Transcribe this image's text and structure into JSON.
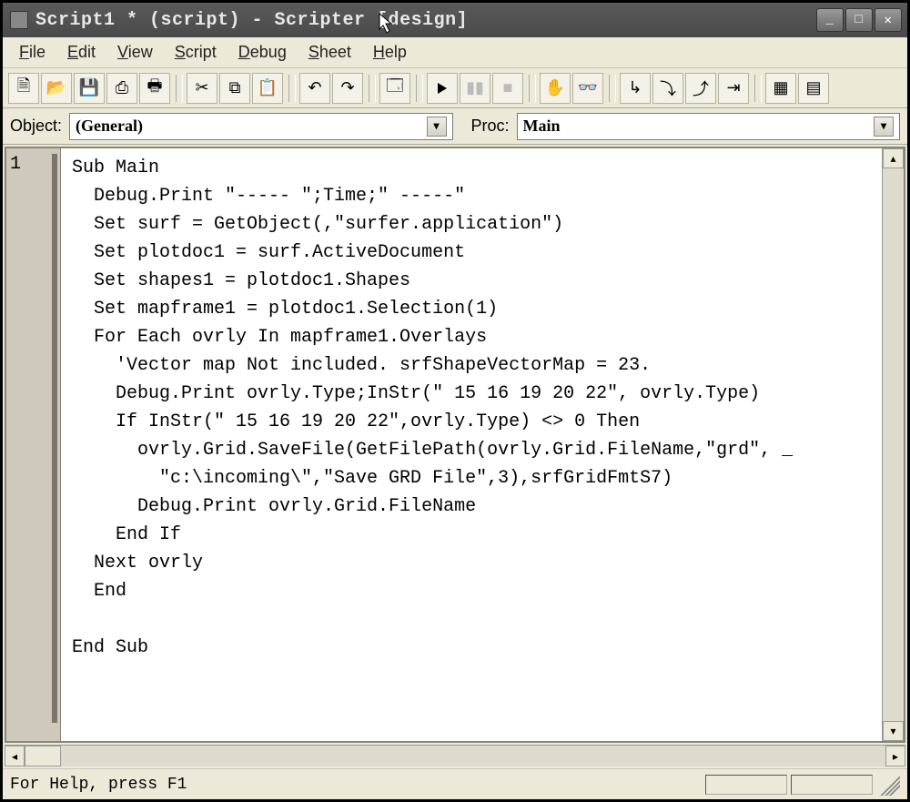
{
  "titlebar": {
    "text": "Script1 * (script) - Scripter [design]"
  },
  "menu": {
    "file": "File",
    "edit": "Edit",
    "view": "View",
    "script": "Script",
    "debug": "Debug",
    "sheet": "Sheet",
    "help": "Help"
  },
  "toolbar_icons": {
    "new": "new-icon",
    "open": "open-icon",
    "save": "save-icon",
    "saveall": "saveall-icon",
    "print": "print-icon",
    "cut": "cut-icon",
    "copy": "copy-icon",
    "paste": "paste-icon",
    "undo": "undo-icon",
    "redo": "redo-icon",
    "dialog": "dialog-icon",
    "run": "run-icon",
    "pause": "pause-icon",
    "stop": "stop-icon",
    "hand": "hand-icon",
    "glasses": "browse-icon",
    "stepinto": "step-into-icon",
    "stepover": "step-over-icon",
    "stepout": "step-out-icon",
    "runto": "run-to-icon",
    "window1": "window-icon",
    "window2": "window2-icon"
  },
  "selectors": {
    "object_label": "Object:",
    "object_value": "(General)",
    "proc_label": "Proc:",
    "proc_value": "Main"
  },
  "gutter": {
    "line1": "1"
  },
  "code": {
    "l1": "Sub Main",
    "l2": "  Debug.Print \"----- \";Time;\" -----\"",
    "l3": "  Set surf = GetObject(,\"surfer.application\")",
    "l4": "  Set plotdoc1 = surf.ActiveDocument",
    "l5": "  Set shapes1 = plotdoc1.Shapes",
    "l6": "  Set mapframe1 = plotdoc1.Selection(1)",
    "l7": "  For Each ovrly In mapframe1.Overlays",
    "l8": "    'Vector map Not included. srfShapeVectorMap = 23.",
    "l9": "    Debug.Print ovrly.Type;InStr(\" 15 16 19 20 22\", ovrly.Type)",
    "l10": "    If InStr(\" 15 16 19 20 22\",ovrly.Type) <> 0 Then",
    "l11": "      ovrly.Grid.SaveFile(GetFilePath(ovrly.Grid.FileName,\"grd\", _",
    "l12": "        \"c:\\incoming\\\",\"Save GRD File\",3),srfGridFmtS7)",
    "l13": "      Debug.Print ovrly.Grid.FileName",
    "l14": "    End If",
    "l15": "  Next ovrly",
    "l16": "  End",
    "l17": "",
    "l18": "End Sub"
  },
  "status": {
    "text": "For Help, press F1"
  }
}
